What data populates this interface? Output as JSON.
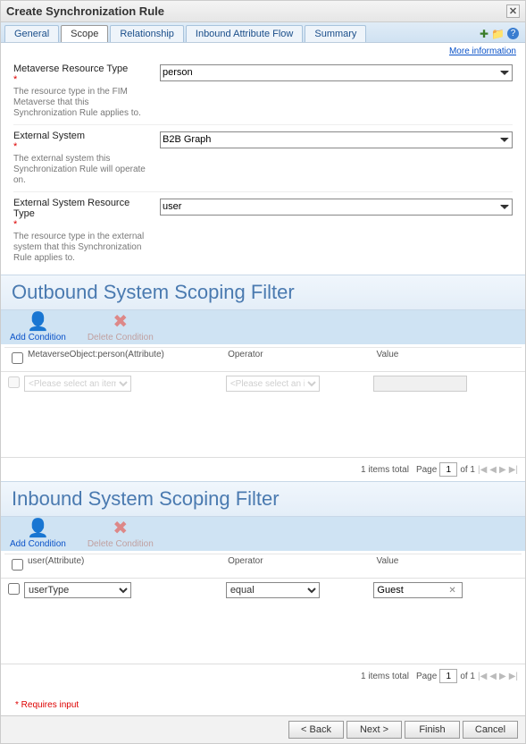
{
  "title": "Create Synchronization Rule",
  "tabs": [
    "General",
    "Scope",
    "Relationship",
    "Inbound Attribute Flow",
    "Summary"
  ],
  "active_tab": 1,
  "moreinfo": "More information",
  "fields": {
    "metaverse_type": {
      "label": "Metaverse Resource Type",
      "desc": "The resource type in the FIM Metaverse that this Synchronization Rule applies to.",
      "value": "person"
    },
    "ext_system": {
      "label": "External System",
      "desc": "The external system this Synchronization Rule will operate on.",
      "value": "B2B Graph"
    },
    "ext_type": {
      "label": "External System Resource Type",
      "desc": "The resource type in the external system that this Synchronization Rule applies to.",
      "value": "user"
    }
  },
  "outbound": {
    "heading": "Outbound System Scoping Filter",
    "add_label": "Add Condition",
    "del_label": "Delete Condition",
    "cols": {
      "attr": "MetaverseObject:person(Attribute)",
      "op": "Operator",
      "val": "Value"
    },
    "placeholder": "<Please select an item>",
    "footer_items": "1 items total",
    "page_label": "Page",
    "page_total": "of 1",
    "page_current": "1"
  },
  "inbound": {
    "heading": "Inbound System Scoping Filter",
    "add_label": "Add Condition",
    "del_label": "Delete Condition",
    "cols": {
      "attr": "user(Attribute)",
      "op": "Operator",
      "val": "Value"
    },
    "row": {
      "attr": "userType",
      "op": "equal",
      "val": "Guest"
    },
    "footer_items": "1 items total",
    "page_label": "Page",
    "page_total": "of 1",
    "page_current": "1"
  },
  "required_note": "* Requires input",
  "buttons": {
    "back": "< Back",
    "next": "Next >",
    "finish": "Finish",
    "cancel": "Cancel"
  }
}
